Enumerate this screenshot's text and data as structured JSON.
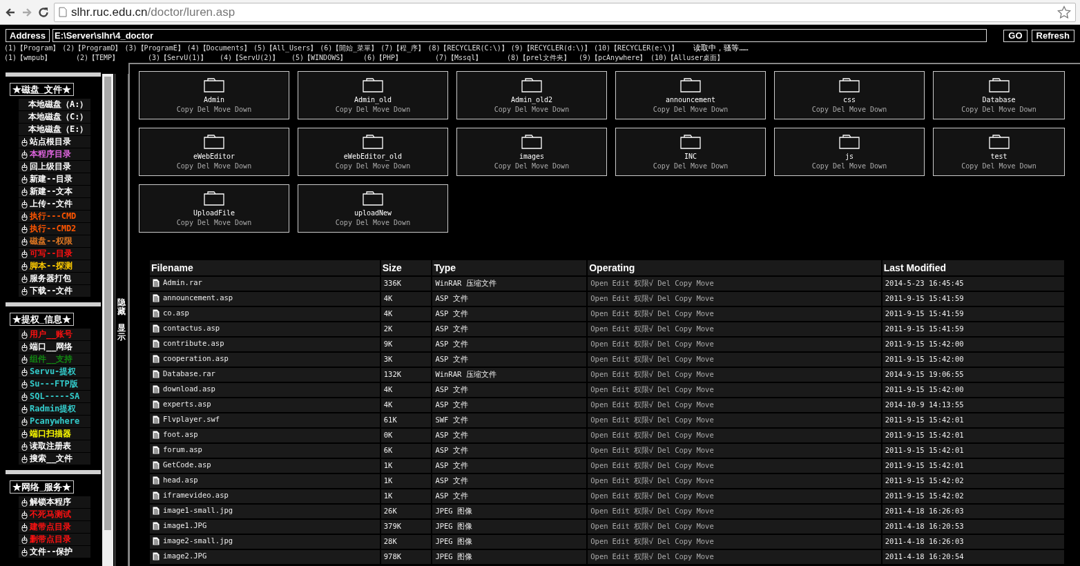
{
  "browser": {
    "url_host": "slhr.ruc.edu.cn",
    "url_path": "/doctor/luren.asp"
  },
  "address_bar": {
    "label": "Address",
    "value": "E:\\Server\\slhr\\4_doctor",
    "buttons": [
      "GO",
      "Refresh"
    ]
  },
  "shortcut_rows": [
    [
      "(1)【Program】",
      "(2)【ProgramD】",
      "(3)【ProgramE】",
      "(4)【Documents】",
      "(5)【All_Users】",
      "(6)【開始_菜單】",
      "(7)【程_序】",
      "(8)【RECYCLER(C:\\)】",
      "(9)【RECYCLER(d:\\)】",
      "(10)【RECYCLER(e:\\)】"
    ],
    [
      "(1)【wmpub】",
      "(2)【TEMP】",
      "(3)【ServU(1)】",
      "(4)【ServU(2)】",
      "(5)【WINDOWS】",
      "(6)【PHP】",
      "(7)【Mssql】",
      "(8)【prel文件夹】",
      "(9)【pcAnywhere】",
      "(10)【Alluser桌面】"
    ]
  ],
  "status_text": "读取中，骚等……",
  "sidebar": {
    "sections": [
      {
        "title": "★磁盘_文件★",
        "items": [
          {
            "label": "本地磁盘（A:）",
            "kind": "drive",
            "color": "#ffffff"
          },
          {
            "label": "本地磁盘（C:）",
            "kind": "drive",
            "color": "#ffffff"
          },
          {
            "label": "本地磁盘（E:）",
            "kind": "drive",
            "color": "#ffffff"
          },
          {
            "label": "站点根目录",
            "kind": "link",
            "color": "#ffffff"
          },
          {
            "label": "本程序目录",
            "kind": "link",
            "color": "#e066e0"
          },
          {
            "label": "回上级目录",
            "kind": "link",
            "color": "#ffffff"
          },
          {
            "label": "新建--目录",
            "kind": "link",
            "color": "#ffffff"
          },
          {
            "label": "新建--文本",
            "kind": "link",
            "color": "#ffffff"
          },
          {
            "label": "上传--文件",
            "kind": "link",
            "color": "#ffffff"
          },
          {
            "label": "执行---CMD",
            "kind": "link",
            "color": "#ff5500"
          },
          {
            "label": "执行--CMD2",
            "kind": "link",
            "color": "#ff5500"
          },
          {
            "label": "磁盘--权限",
            "kind": "link",
            "color": "#e07722"
          },
          {
            "label": "可写--目录",
            "kind": "link",
            "color": "#ff1111"
          },
          {
            "label": "脚本--探测",
            "kind": "link",
            "color": "#ffcc00"
          },
          {
            "label": "服务器打包",
            "kind": "link",
            "color": "#ffffff"
          },
          {
            "label": "下载--文件",
            "kind": "link",
            "color": "#ffffff"
          }
        ]
      },
      {
        "title": "★提权_信息★",
        "items": [
          {
            "label": "用户__账号",
            "kind": "link",
            "color": "#ff1111"
          },
          {
            "label": "端口__网络",
            "kind": "link",
            "color": "#ffffff"
          },
          {
            "label": "组件__支持",
            "kind": "link",
            "color": "#118811"
          },
          {
            "label": "Servu-提权",
            "kind": "link",
            "color": "#33cccc"
          },
          {
            "label": "Su---FTP版",
            "kind": "link",
            "color": "#33cccc"
          },
          {
            "label": "SQL-----SA",
            "kind": "link",
            "color": "#33cccc"
          },
          {
            "label": "Radmin提权",
            "kind": "link",
            "color": "#33cccc"
          },
          {
            "label": "Pcanywhere",
            "kind": "link",
            "color": "#33cccc"
          },
          {
            "label": "端口扫描器",
            "kind": "link",
            "color": "#ffff00"
          },
          {
            "label": "读取注册表",
            "kind": "link",
            "color": "#ffffff"
          },
          {
            "label": "搜索__文件",
            "kind": "link",
            "color": "#ffffff"
          }
        ]
      },
      {
        "title": "★网络_服务★",
        "items": [
          {
            "label": "解锁本程序",
            "kind": "link",
            "color": "#ffffff"
          },
          {
            "label": "不死马测试",
            "kind": "link",
            "color": "#ff1111"
          },
          {
            "label": "建带点目录",
            "kind": "link",
            "color": "#ff1111"
          },
          {
            "label": "删带点目录",
            "kind": "link",
            "color": "#ff1111"
          },
          {
            "label": "文件--保护",
            "kind": "link",
            "color": "#ffffff"
          }
        ]
      }
    ]
  },
  "toggle": [
    "隐藏",
    "显示"
  ],
  "folders": [
    {
      "name": "Admin",
      "actions": [
        "Copy",
        "Del",
        "Move",
        "Down"
      ]
    },
    {
      "name": "Admin_old",
      "actions": [
        "Copy",
        "Del",
        "Move",
        "Down"
      ]
    },
    {
      "name": "Admin_old2",
      "actions": [
        "Copy",
        "Del",
        "Move",
        "Down"
      ]
    },
    {
      "name": "announcement",
      "actions": [
        "Copy",
        "Del",
        "Move",
        "Down"
      ]
    },
    {
      "name": "css",
      "actions": [
        "Copy",
        "Del",
        "Move",
        "Down"
      ]
    },
    {
      "name": "Database",
      "actions": [
        "Copy",
        "Del",
        "Move",
        "Down"
      ]
    },
    {
      "name": "eWebEditor",
      "actions": [
        "Copy",
        "Del",
        "Move",
        "Down"
      ]
    },
    {
      "name": "eWebEditor_old",
      "actions": [
        "Copy",
        "Del",
        "Move",
        "Down"
      ]
    },
    {
      "name": "images",
      "actions": [
        "Copy",
        "Del",
        "Move",
        "Down"
      ]
    },
    {
      "name": "INC",
      "actions": [
        "Copy",
        "Del",
        "Move",
        "Down"
      ]
    },
    {
      "name": "js",
      "actions": [
        "Copy",
        "Del",
        "Move",
        "Down"
      ]
    },
    {
      "name": "test",
      "actions": [
        "Copy",
        "Del",
        "Move",
        "Down"
      ]
    },
    {
      "name": "UploadFile",
      "actions": [
        "Copy",
        "Del",
        "Move",
        "Down"
      ]
    },
    {
      "name": "uploadNew",
      "actions": [
        "Copy",
        "Del",
        "Move",
        "Down"
      ]
    }
  ],
  "table": {
    "columns": [
      "Filename",
      "Size",
      "Type",
      "Operating",
      "Last Modified"
    ],
    "rows": [
      {
        "filename": "Admin.rar",
        "size": "336K",
        "type": "WinRAR 压缩文件",
        "operations": [
          "Open",
          "Edit",
          "权限√",
          "Del",
          "Copy",
          "Move"
        ],
        "modified": "2014-5-23 16:45:45"
      },
      {
        "filename": "announcement.asp",
        "size": "4K",
        "type": "ASP 文件",
        "operations": [
          "Open",
          "Edit",
          "权限√",
          "Del",
          "Copy",
          "Move"
        ],
        "modified": "2011-9-15 15:41:59"
      },
      {
        "filename": "co.asp",
        "size": "4K",
        "type": "ASP 文件",
        "operations": [
          "Open",
          "Edit",
          "权限√",
          "Del",
          "Copy",
          "Move"
        ],
        "modified": "2011-9-15 15:41:59"
      },
      {
        "filename": "contactus.asp",
        "size": "2K",
        "type": "ASP 文件",
        "operations": [
          "Open",
          "Edit",
          "权限√",
          "Del",
          "Copy",
          "Move"
        ],
        "modified": "2011-9-15 15:41:59"
      },
      {
        "filename": "contribute.asp",
        "size": "9K",
        "type": "ASP 文件",
        "operations": [
          "Open",
          "Edit",
          "权限√",
          "Del",
          "Copy",
          "Move"
        ],
        "modified": "2011-9-15 15:42:00"
      },
      {
        "filename": "cooperation.asp",
        "size": "3K",
        "type": "ASP 文件",
        "operations": [
          "Open",
          "Edit",
          "权限√",
          "Del",
          "Copy",
          "Move"
        ],
        "modified": "2011-9-15 15:42:00"
      },
      {
        "filename": "Database.rar",
        "size": "132K",
        "type": "WinRAR 压缩文件",
        "operations": [
          "Open",
          "Edit",
          "权限√",
          "Del",
          "Copy",
          "Move"
        ],
        "modified": "2014-9-15 19:06:55"
      },
      {
        "filename": "download.asp",
        "size": "4K",
        "type": "ASP 文件",
        "operations": [
          "Open",
          "Edit",
          "权限√",
          "Del",
          "Copy",
          "Move"
        ],
        "modified": "2011-9-15 15:42:00"
      },
      {
        "filename": "experts.asp",
        "size": "4K",
        "type": "ASP 文件",
        "operations": [
          "Open",
          "Edit",
          "权限√",
          "Del",
          "Copy",
          "Move"
        ],
        "modified": "2014-10-9 14:13:55"
      },
      {
        "filename": "Flvplayer.swf",
        "size": "61K",
        "type": "SWF 文件",
        "operations": [
          "Open",
          "Edit",
          "权限√",
          "Del",
          "Copy",
          "Move"
        ],
        "modified": "2011-9-15 15:42:01"
      },
      {
        "filename": "foot.asp",
        "size": "0K",
        "type": "ASP 文件",
        "operations": [
          "Open",
          "Edit",
          "权限√",
          "Del",
          "Copy",
          "Move"
        ],
        "modified": "2011-9-15 15:42:01"
      },
      {
        "filename": "forum.asp",
        "size": "6K",
        "type": "ASP 文件",
        "operations": [
          "Open",
          "Edit",
          "权限√",
          "Del",
          "Copy",
          "Move"
        ],
        "modified": "2011-9-15 15:42:01"
      },
      {
        "filename": "GetCode.asp",
        "size": "1K",
        "type": "ASP 文件",
        "operations": [
          "Open",
          "Edit",
          "权限√",
          "Del",
          "Copy",
          "Move"
        ],
        "modified": "2011-9-15 15:42:01"
      },
      {
        "filename": "head.asp",
        "size": "1K",
        "type": "ASP 文件",
        "operations": [
          "Open",
          "Edit",
          "权限√",
          "Del",
          "Copy",
          "Move"
        ],
        "modified": "2011-9-15 15:42:02"
      },
      {
        "filename": "iframevideo.asp",
        "size": "1K",
        "type": "ASP 文件",
        "operations": [
          "Open",
          "Edit",
          "权限√",
          "Del",
          "Copy",
          "Move"
        ],
        "modified": "2011-9-15 15:42:02"
      },
      {
        "filename": "image1-small.jpg",
        "size": "26K",
        "type": "JPEG 图像",
        "operations": [
          "Open",
          "Edit",
          "权限√",
          "Del",
          "Copy",
          "Move"
        ],
        "modified": "2011-4-18 16:26:03"
      },
      {
        "filename": "image1.JPG",
        "size": "379K",
        "type": "JPEG 图像",
        "operations": [
          "Open",
          "Edit",
          "权限√",
          "Del",
          "Copy",
          "Move"
        ],
        "modified": "2011-4-18 16:20:53"
      },
      {
        "filename": "image2-small.jpg",
        "size": "28K",
        "type": "JPEG 图像",
        "operations": [
          "Open",
          "Edit",
          "权限√",
          "Del",
          "Copy",
          "Move"
        ],
        "modified": "2011-4-18 16:26:03"
      },
      {
        "filename": "image2.JPG",
        "size": "978K",
        "type": "JPEG 图像",
        "operations": [
          "Open",
          "Edit",
          "权限√",
          "Del",
          "Copy",
          "Move"
        ],
        "modified": "2011-4-18 16:20:54"
      }
    ]
  }
}
